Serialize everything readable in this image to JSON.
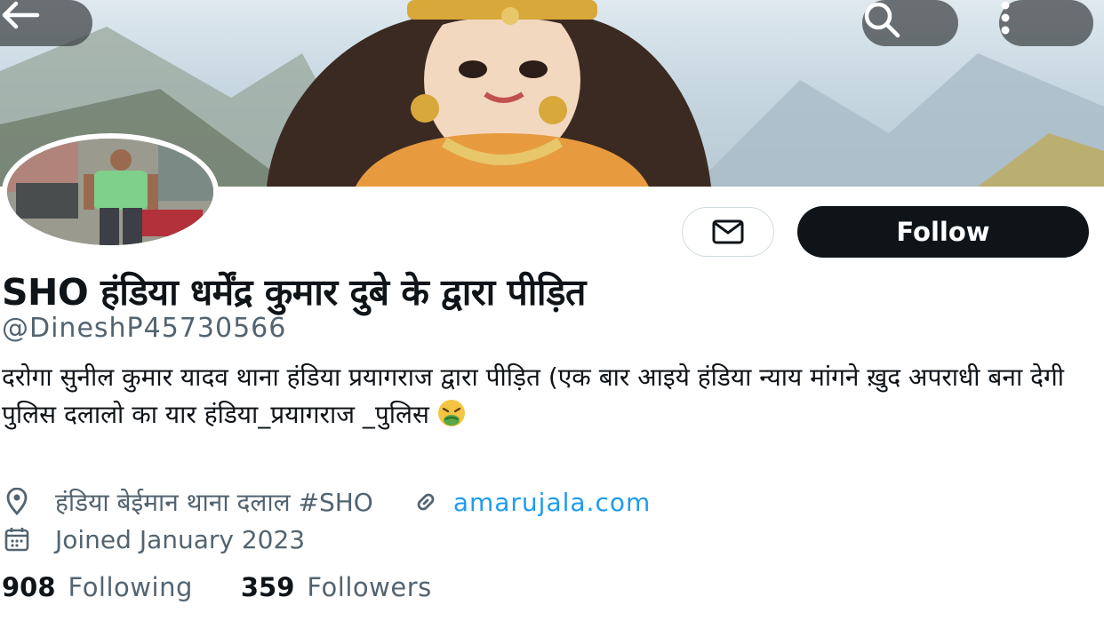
{
  "header": {
    "back_icon": "arrow-left-icon",
    "search_icon": "search-icon",
    "more_icon": "more-vertical-icon"
  },
  "profile": {
    "display_name": "SHO हंडिया धर्मेंद्र कुमार दुबे के द्वारा पीड़ित",
    "handle": "@DineshP45730566",
    "bio": "दरोगा सुनील कुमार यादव थाना हंडिया प्रयागराज द्वारा पीड़ित (एक बार आइये हंडिया न्याय मांगने ख़ुद अपराधी बना देगी पुलिस दलालो का यार हंडिया_प्रयागराज _पुलिस",
    "location": "हंडिया बेईमान थाना दलाल #SHO",
    "website": "amarujala.com",
    "joined": "Joined January 2023",
    "following_count": "908",
    "following_label": "Following",
    "followers_count": "359",
    "followers_label": "Followers"
  },
  "actions": {
    "message_icon": "mail-icon",
    "follow_label": "Follow"
  },
  "colors": {
    "text_primary": "#0f1419",
    "text_secondary": "#536471",
    "link": "#1d9bf0",
    "follow_bg": "#0f1419"
  }
}
